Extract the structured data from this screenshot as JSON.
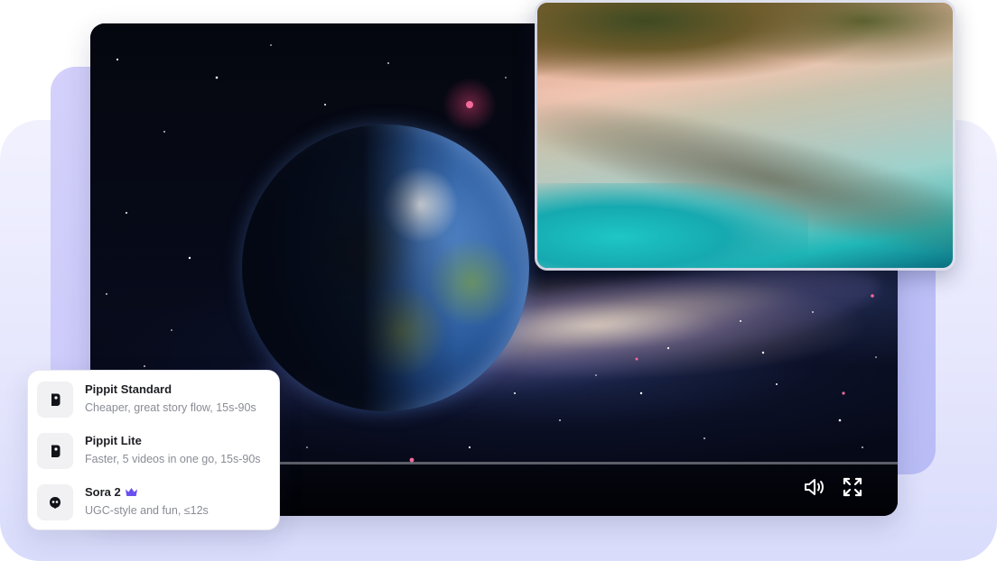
{
  "player": {
    "progress_percent": 23,
    "volume_icon": "volume-icon",
    "fullscreen_icon": "fullscreen-icon"
  },
  "models": [
    {
      "name": "Pippit Standard",
      "description": "Cheaper, great story flow, 15s-90s",
      "icon": "pippit-logo-icon",
      "premium": false
    },
    {
      "name": "Pippit Lite",
      "description": "Faster, 5 videos in one go, 15s-90s",
      "icon": "pippit-logo-icon",
      "premium": false
    },
    {
      "name": "Sora 2",
      "description": "UGC-style and fun, ≤12s",
      "icon": "sora-logo-icon",
      "premium": true
    }
  ],
  "colors": {
    "accent": "#6a4ff0",
    "background_light": "#e6e7fd",
    "background_mid": "#c4c5f8"
  }
}
